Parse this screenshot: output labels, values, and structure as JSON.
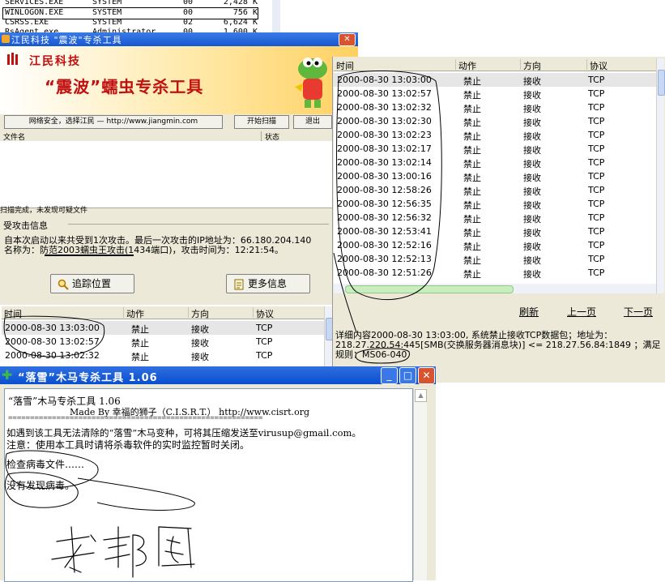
{
  "process_list": {
    "rows": [
      {
        "name": "SERVICES.EXE",
        "user": "SYSTEM",
        "cpu": "00",
        "mem": "2,428 K"
      },
      {
        "name": "WINLOGON.EXE",
        "user": "SYSTEM",
        "cpu": "00",
        "mem": "756 K"
      },
      {
        "name": "CSRSS.EXE",
        "user": "SYSTEM",
        "cpu": "02",
        "mem": "6,624 K"
      },
      {
        "name": "RsAgent.exe",
        "user": "Administrator",
        "cpu": "00",
        "mem": "1,600 K"
      }
    ]
  },
  "wave_window": {
    "title": "江民科技   \"震波\"专杀工具",
    "close": "✕",
    "logo_text": "江民科技",
    "banner_title": "“震波”蠕虫专杀工具",
    "slogan_button": "网络安全，选择江民 — http://www.jiangmin.com",
    "scan_button": "开始扫描",
    "exit_button": "退出",
    "file_col_name": "文件名",
    "file_col_status": "状态",
    "scan_status": "扫描完成，未发现可疑文件",
    "attack_group_label": "受攻击信息",
    "attack_line1": "自本次启动以来共受到1次攻击。最后一次攻击的IP地址为：66.180.204.140",
    "attack_line2": "名称为：防范2003蠕虫王攻击(1434端口)，攻击时间为：12:21:54。",
    "trace_button": "追踪位置",
    "more_button": "更多信息",
    "table": {
      "headers": [
        "时间",
        "动作",
        "方向",
        "协议"
      ],
      "rows": [
        [
          "2000-08-30 13:03:00",
          "禁止",
          "接收",
          "TCP"
        ],
        [
          "2000-08-30 13:02:57",
          "禁止",
          "接收",
          "TCP"
        ],
        [
          "2000-08-30 13:02:32",
          "禁止",
          "接收",
          "TCP"
        ]
      ]
    }
  },
  "log_window": {
    "headers": [
      "时间",
      "动作",
      "方向",
      "协议"
    ],
    "rows": [
      [
        "2000-08-30 13:03:00",
        "禁止",
        "接收",
        "TCP"
      ],
      [
        "2000-08-30 13:02:57",
        "禁止",
        "接收",
        "TCP"
      ],
      [
        "2000-08-30 13:02:32",
        "禁止",
        "接收",
        "TCP"
      ],
      [
        "2000-08-30 13:02:30",
        "禁止",
        "接收",
        "TCP"
      ],
      [
        "2000-08-30 13:02:23",
        "禁止",
        "接收",
        "TCP"
      ],
      [
        "2000-08-30 13:02:17",
        "禁止",
        "接收",
        "TCP"
      ],
      [
        "2000-08-30 13:02:14",
        "禁止",
        "接收",
        "TCP"
      ],
      [
        "2000-08-30 13:00:16",
        "禁止",
        "接收",
        "TCP"
      ],
      [
        "2000-08-30 12:58:26",
        "禁止",
        "接收",
        "TCP"
      ],
      [
        "2000-08-30 12:56:35",
        "禁止",
        "接收",
        "TCP"
      ],
      [
        "2000-08-30 12:56:32",
        "禁止",
        "接收",
        "TCP"
      ],
      [
        "2000-08-30 12:53:41",
        "禁止",
        "接收",
        "TCP"
      ],
      [
        "2000-08-30 12:52:16",
        "禁止",
        "接收",
        "TCP"
      ],
      [
        "2000-08-30 12:52:13",
        "禁止",
        "接收",
        "TCP"
      ],
      [
        "2000-08-30 12:51:26",
        "禁止",
        "接收",
        "TCP"
      ]
    ],
    "refresh": "刷新",
    "prev_page": "上一页",
    "next_page": "下一页",
    "detail_line1": "详细内容2000-08-30 13:03:00, 系统禁止接收TCP数据包；地址为：",
    "detail_line2": "218.27.220.54:445[SMB(交换服务器消息块)] <= 218.27.56.84:1849 ；满足",
    "detail_line3": "规则：MS06-040"
  },
  "luoxue_window": {
    "title": "“落雪”木马专杀工具 1.06",
    "minimize": "_",
    "maximize": "□",
    "close": "✕",
    "line1": "“落雪”木马专杀工具 1.06",
    "line2": "Made By 幸福的狮子（C.I.S.R.T.）        http://www.cisrt.org",
    "separator": "==========================================================",
    "line3": "如遇到该工具无法清除的“落雪”木马变种，可将其压缩发送至virusup@gmail.com。",
    "line4": "注意：使用本工具时请将杀毒软件的实时监控暂时关闭。",
    "line5": "检查病毒文件……",
    "line6": "没有发现病毒。"
  },
  "colors": {
    "title_blue": "#1556d2",
    "brand_red": "#c01010",
    "window_bg": "#ece9d8"
  }
}
